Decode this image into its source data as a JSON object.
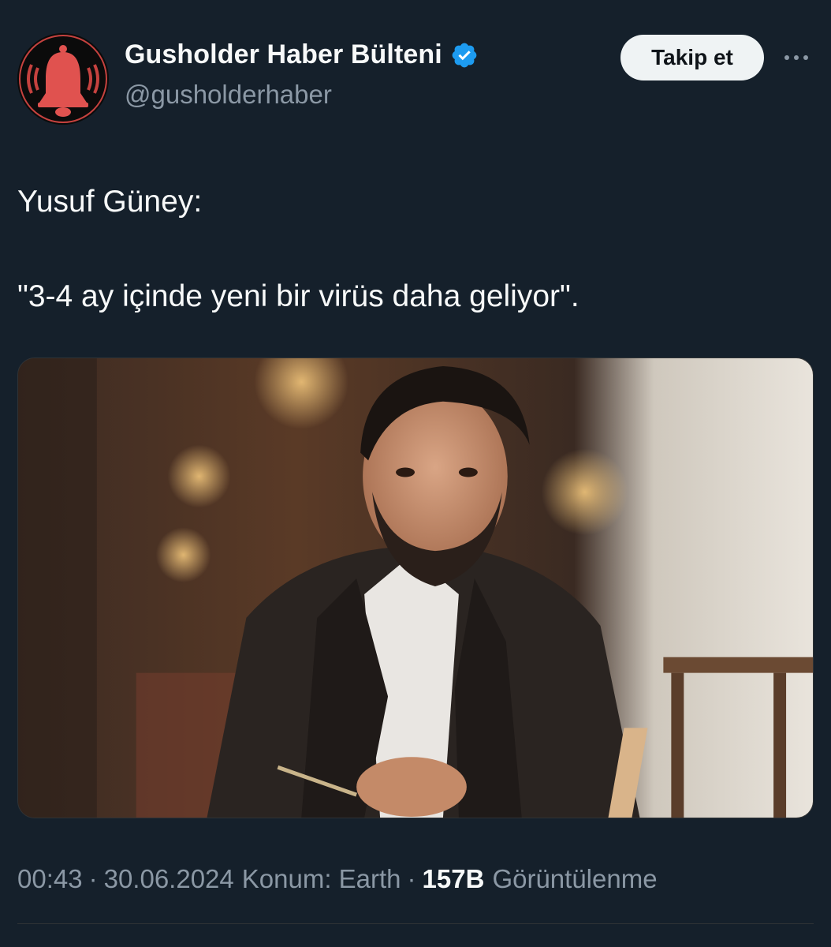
{
  "author": {
    "display_name": "Gusholder Haber Bülteni",
    "handle": "@gusholderhaber",
    "verified_icon": "verified-badge-icon",
    "avatar_icon": "bell-icon",
    "verified_color": "#1d9bf0",
    "avatar_bell_color": "#e0524f"
  },
  "actions": {
    "follow_label": "Takip et",
    "more_icon": "more-horizontal-icon"
  },
  "tweet": {
    "lines": [
      "Yusuf Güney:",
      "\"3-4 ay içinde yeni bir virüs daha geliyor\"."
    ],
    "media": {
      "type": "photo"
    }
  },
  "meta": {
    "time": "00:43",
    "separator": "·",
    "date": "30.06.2024",
    "location": "Konum: Earth",
    "views_count": "157B",
    "views_label": "Görüntülenme"
  },
  "theme": {
    "background": "#15202b",
    "text_primary": "#f7f9f9",
    "text_secondary": "#8b98a5",
    "button_bg": "#eff3f4"
  }
}
